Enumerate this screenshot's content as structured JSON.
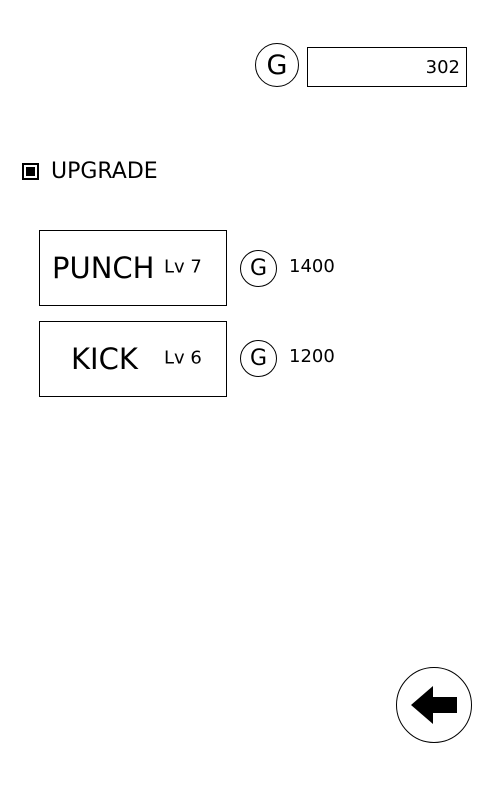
{
  "gold": {
    "icon_letter": "G",
    "amount": "302"
  },
  "section": {
    "title": "UPGRADE",
    "icon": "square-bullet-icon"
  },
  "upgrades": [
    {
      "name": "PUNCH",
      "level": "Lv 7",
      "cost_icon_letter": "G",
      "cost": "1400"
    },
    {
      "name": "KICK",
      "level": "Lv 6",
      "cost_icon_letter": "G",
      "cost": "1200"
    }
  ],
  "back": {
    "icon": "back-arrow-icon"
  }
}
